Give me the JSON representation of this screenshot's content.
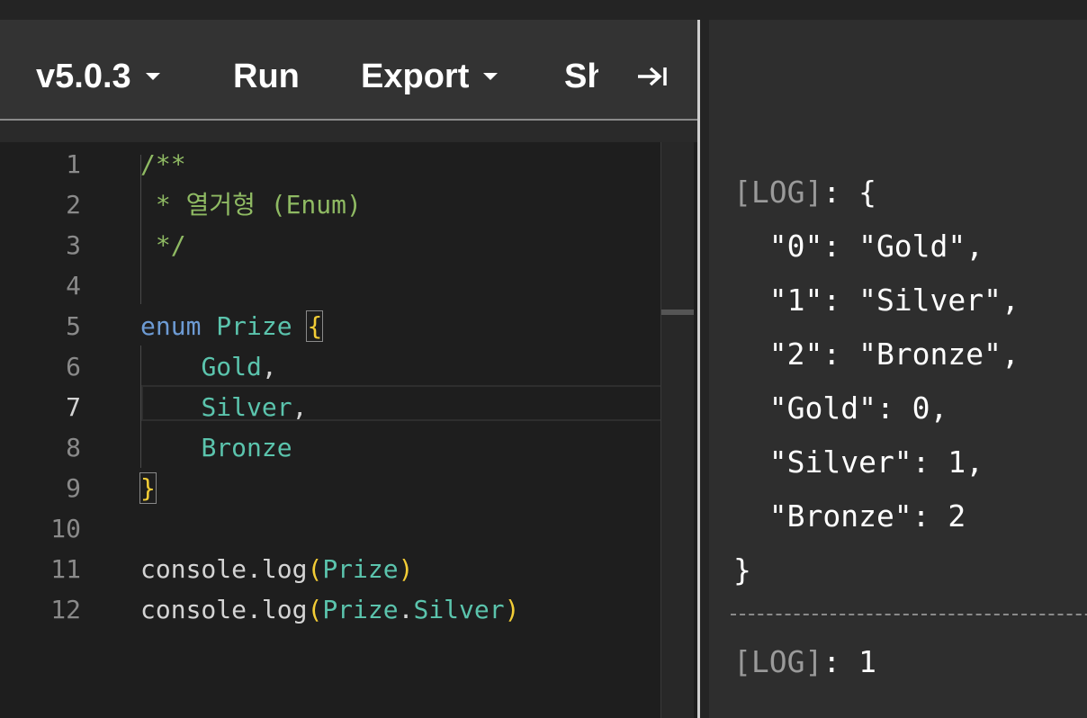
{
  "toolbar": {
    "version_label": "v5.0.3",
    "run_label": "Run",
    "export_label": "Export",
    "share_label_clipped": "Sh"
  },
  "editor": {
    "lines": [
      {
        "num": "1",
        "tokens": [
          {
            "t": "/**",
            "c": "comment"
          }
        ]
      },
      {
        "num": "2",
        "tokens": [
          {
            "t": " * 열거형 (Enum)",
            "c": "comment"
          }
        ]
      },
      {
        "num": "3",
        "tokens": [
          {
            "t": " */",
            "c": "comment"
          }
        ]
      },
      {
        "num": "4",
        "tokens": []
      },
      {
        "num": "5",
        "tokens": [
          {
            "t": "enum",
            "c": "kw"
          },
          {
            "t": " ",
            "c": "plain"
          },
          {
            "t": "Prize",
            "c": "type"
          },
          {
            "t": " ",
            "c": "plain"
          },
          {
            "t": "{",
            "c": "brace",
            "box": true
          }
        ]
      },
      {
        "num": "6",
        "tokens": [
          {
            "t": "    ",
            "c": "plain"
          },
          {
            "t": "Gold",
            "c": "type"
          },
          {
            "t": ",",
            "c": "plain"
          }
        ]
      },
      {
        "num": "7",
        "active": true,
        "tokens": [
          {
            "t": "    ",
            "c": "plain"
          },
          {
            "t": "Silver",
            "c": "type"
          },
          {
            "t": ",",
            "c": "plain"
          }
        ]
      },
      {
        "num": "8",
        "tokens": [
          {
            "t": "    ",
            "c": "plain"
          },
          {
            "t": "Bronze",
            "c": "type"
          }
        ]
      },
      {
        "num": "9",
        "tokens": [
          {
            "t": "}",
            "c": "brace",
            "box": true
          }
        ]
      },
      {
        "num": "10",
        "tokens": []
      },
      {
        "num": "11",
        "tokens": [
          {
            "t": "console",
            "c": "plain"
          },
          {
            "t": ".",
            "c": "plain"
          },
          {
            "t": "log",
            "c": "plain"
          },
          {
            "t": "(",
            "c": "brace"
          },
          {
            "t": "Prize",
            "c": "type"
          },
          {
            "t": ")",
            "c": "brace"
          }
        ]
      },
      {
        "num": "12",
        "tokens": [
          {
            "t": "console",
            "c": "plain"
          },
          {
            "t": ".",
            "c": "plain"
          },
          {
            "t": "log",
            "c": "plain"
          },
          {
            "t": "(",
            "c": "brace"
          },
          {
            "t": "Prize",
            "c": "type"
          },
          {
            "t": ".",
            "c": "plain"
          },
          {
            "t": "Silver",
            "c": "type"
          },
          {
            "t": ")",
            "c": "brace"
          }
        ]
      }
    ]
  },
  "output": {
    "log1": {
      "tag": "[LOG]",
      "lines": [
        ": {",
        "  \"0\": \"Gold\",",
        "  \"1\": \"Silver\",",
        "  \"2\": \"Bronze\",",
        "  \"Gold\": 0,",
        "  \"Silver\": 1,",
        "  \"Bronze\": 2",
        "}"
      ]
    },
    "log2": {
      "tag": "[LOG]",
      "text": ": 1"
    }
  },
  "colors": {
    "comment": "#8fba63",
    "keyword": "#6d9bd4",
    "type": "#5bc4ad",
    "brace": "#f3cd36",
    "plain": "#d4d4d4"
  },
  "icons": {
    "version_caret": "chevron-down-icon",
    "export_caret": "chevron-down-icon",
    "collapse": "arrow-to-right-icon"
  }
}
